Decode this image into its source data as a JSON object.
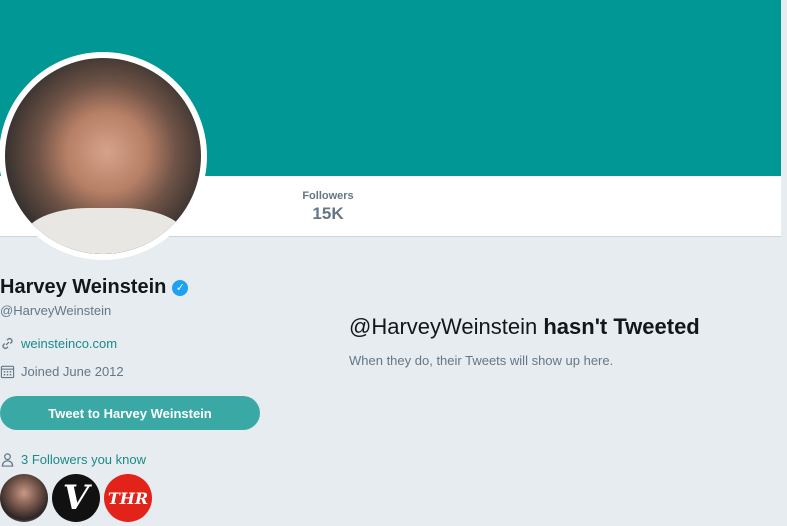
{
  "profile": {
    "name": "Harvey Weinstein",
    "handle": "@HarveyWeinstein",
    "website": "weinsteinco.com",
    "joined": "Joined June 2012",
    "verified": true
  },
  "stats": {
    "followers_label": "Followers",
    "followers_value": "15K"
  },
  "actions": {
    "tweet_to_label": "Tweet to Harvey Weinstein"
  },
  "followers_you_know": {
    "label": "3 Followers you know",
    "avatars": [
      {
        "icon": "person-photo",
        "text": ""
      },
      {
        "icon": "v-logo",
        "text": "V"
      },
      {
        "icon": "thr-logo",
        "text": "THR"
      }
    ]
  },
  "timeline": {
    "empty_handle": "@HarveyWeinstein",
    "empty_suffix": "hasn't Tweeted",
    "empty_sub": "When they do, their Tweets will show up here."
  },
  "colors": {
    "header": "#009794",
    "accent": "#1c8a88",
    "button": "#3aa9a6",
    "verified": "#1da1f2",
    "page_bg": "#e6ecf0"
  }
}
